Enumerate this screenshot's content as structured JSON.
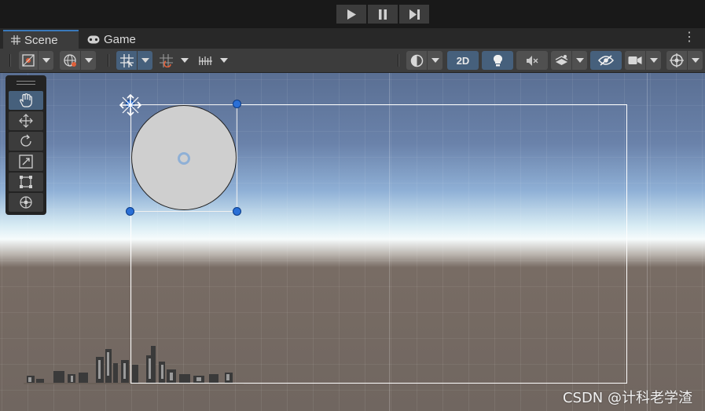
{
  "playbar": {
    "buttons": [
      {
        "name": "play",
        "icon": "play-icon"
      },
      {
        "name": "pause",
        "icon": "pause-icon"
      },
      {
        "name": "step",
        "icon": "step-icon"
      }
    ]
  },
  "tabs": {
    "scene_label": "Scene",
    "game_label": "Game",
    "scene_icon": "grid-hash-icon",
    "game_icon": "gamepad-icon",
    "menu_icon": "kebab-menu-icon"
  },
  "toolbar": {
    "mode_2d_label": "2D",
    "icons": [
      "view-options-icon",
      "global-local-icon",
      "grid-snapping-icon",
      "increment-snap-icon",
      "ruler-icon",
      "draw-mode-icon",
      "lighting-icon",
      "audio-mute-icon",
      "effects-icon",
      "visibility-icon",
      "camera-icon",
      "gizmos-icon"
    ]
  },
  "tools": [
    "hand-tool-icon",
    "move-tool-icon",
    "rotate-tool-icon",
    "scale-tool-icon",
    "rect-tool-icon",
    "transform-tool-icon"
  ],
  "colors": {
    "accent": "#3a79bb",
    "toggle_on": "#46607c",
    "handle": "#2a6fd6",
    "sprite_fill": "#cfcfcf"
  },
  "watermark": "CSDN @计科老学渣"
}
